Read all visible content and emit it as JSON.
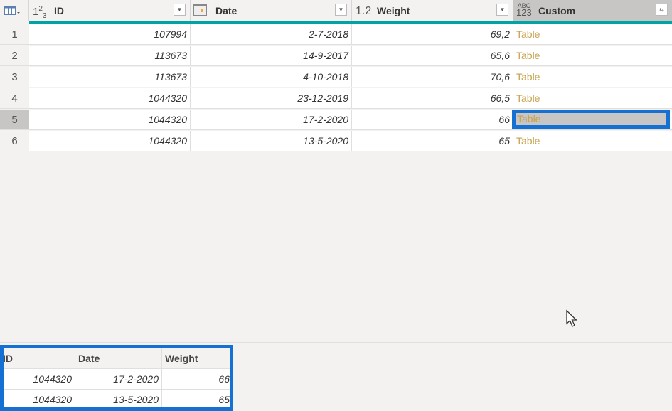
{
  "columns": [
    {
      "type_icon": "1²₃",
      "name": "ID"
    },
    {
      "type_icon": "calendar",
      "name": "Date"
    },
    {
      "type_icon": "1.2",
      "name": "Weight"
    },
    {
      "type_icon": "ABC 123",
      "name": "Custom"
    }
  ],
  "rows": [
    {
      "n": "1",
      "id": "107994",
      "date": "2-7-2018",
      "weight": "69,2",
      "custom": "Table"
    },
    {
      "n": "2",
      "id": "113673",
      "date": "14-9-2017",
      "weight": "65,6",
      "custom": "Table"
    },
    {
      "n": "3",
      "id": "113673",
      "date": "4-10-2018",
      "weight": "70,6",
      "custom": "Table"
    },
    {
      "n": "4",
      "id": "1044320",
      "date": "23-12-2019",
      "weight": "66,5",
      "custom": "Table"
    },
    {
      "n": "5",
      "id": "1044320",
      "date": "17-2-2020",
      "weight": "66",
      "custom": "Table"
    },
    {
      "n": "6",
      "id": "1044320",
      "date": "13-5-2020",
      "weight": "65",
      "custom": "Table"
    }
  ],
  "selected_row": 5,
  "preview": {
    "headers": [
      "ID",
      "Date",
      "Weight"
    ],
    "rows": [
      [
        "1044320",
        "17-2-2020",
        "66"
      ],
      [
        "1044320",
        "13-5-2020",
        "65"
      ]
    ]
  },
  "colors": {
    "accent": "#01a3a4",
    "highlight": "#1570d4",
    "table_link": "#c9a24e"
  }
}
